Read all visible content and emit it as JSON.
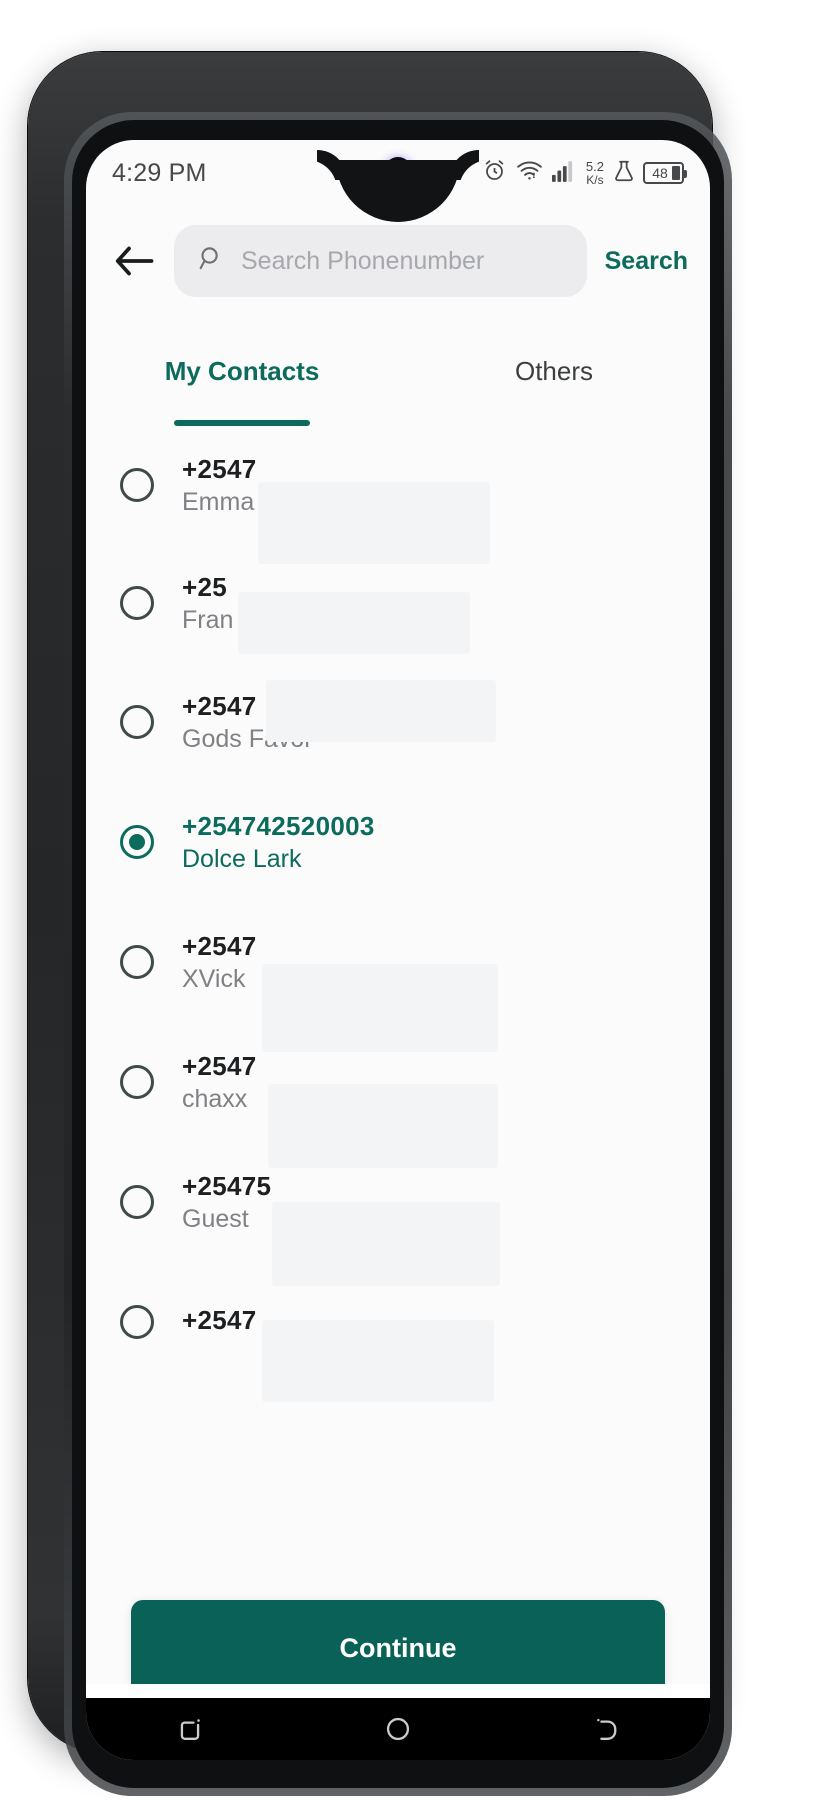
{
  "status_bar": {
    "time": "4:29 PM",
    "alarm_icon": "alarm-icon",
    "wifi_icon": "wifi-icon",
    "signal_icon": "signal-bars-icon",
    "net_speed_value": "5.2",
    "net_speed_unit": "K/s",
    "lab_icon": "flask-icon",
    "battery_level": "48"
  },
  "app_bar": {
    "back_icon": "back-arrow-icon",
    "search_icon": "search-icon",
    "search_value": "",
    "search_placeholder": "Search Phonenumber",
    "search_action_label": "Search"
  },
  "tabs": [
    {
      "label": "My Contacts",
      "active": true
    },
    {
      "label": "Others",
      "active": false
    }
  ],
  "contacts": [
    {
      "phone": "+2547",
      "name": "Emma",
      "selected": false,
      "redacted": true
    },
    {
      "phone": "+25",
      "name": "Fran",
      "selected": false,
      "redacted": true
    },
    {
      "phone": "+2547",
      "name": "Gods Favor",
      "selected": false,
      "redacted": true
    },
    {
      "phone": "+254742520003",
      "name": "Dolce Lark",
      "selected": true,
      "redacted": false
    },
    {
      "phone": "+2547",
      "name": "XVick",
      "selected": false,
      "redacted": true
    },
    {
      "phone": "+2547",
      "name": "chaxx",
      "selected": false,
      "redacted": true
    },
    {
      "phone": "+25475",
      "name": "Guest",
      "selected": false,
      "redacted": true
    },
    {
      "phone": "+2547",
      "name": "",
      "selected": false,
      "redacted": true
    }
  ],
  "footer": {
    "continue_label": "Continue"
  },
  "nav_bar": {
    "recents_icon": "recents-icon",
    "home_icon": "home-circle-icon",
    "back_icon": "back-gesture-icon"
  },
  "colors": {
    "accent": "#0c6b5c",
    "button": "#0a6157",
    "screen_bg": "#fbfbfb",
    "search_bg": "#ececee",
    "muted_text": "#7f8184"
  }
}
